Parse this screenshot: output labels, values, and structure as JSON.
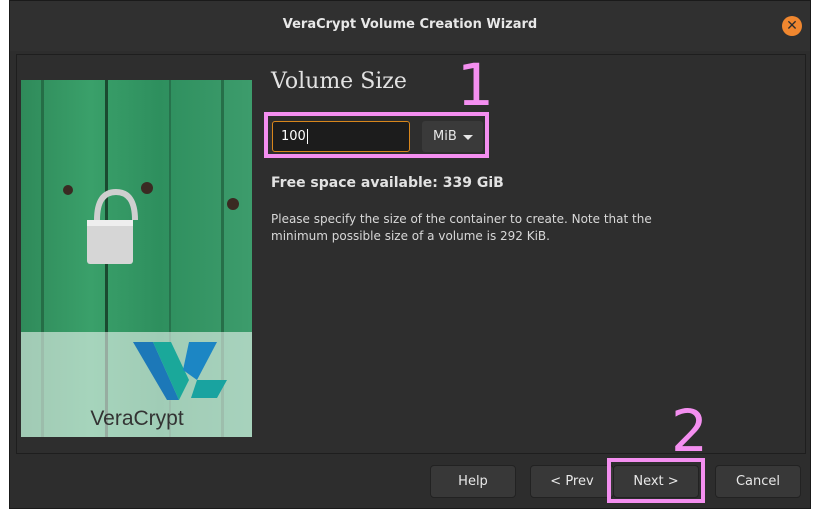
{
  "window": {
    "title": "VeraCrypt Volume Creation Wizard",
    "close_glyph": "✕"
  },
  "side_image": {
    "logo_text": "VeraCrypt"
  },
  "page": {
    "heading": "Volume Size",
    "size_value": "100",
    "unit_selected": "MiB",
    "free_space": "Free space available: 339 GiB",
    "description": "Please specify the size of the container to create. Note that the minimum possible size of a volume is 292 KiB."
  },
  "annotations": {
    "marker1": "1",
    "marker2": "2",
    "highlight_color": "#f48ff0"
  },
  "buttons": {
    "help": "Help",
    "prev": "< Prev",
    "next": "Next >",
    "cancel": "Cancel"
  },
  "colors": {
    "accent_orange": "#f0872f",
    "input_border": "#d8861c",
    "background": "#2d2d2d"
  }
}
